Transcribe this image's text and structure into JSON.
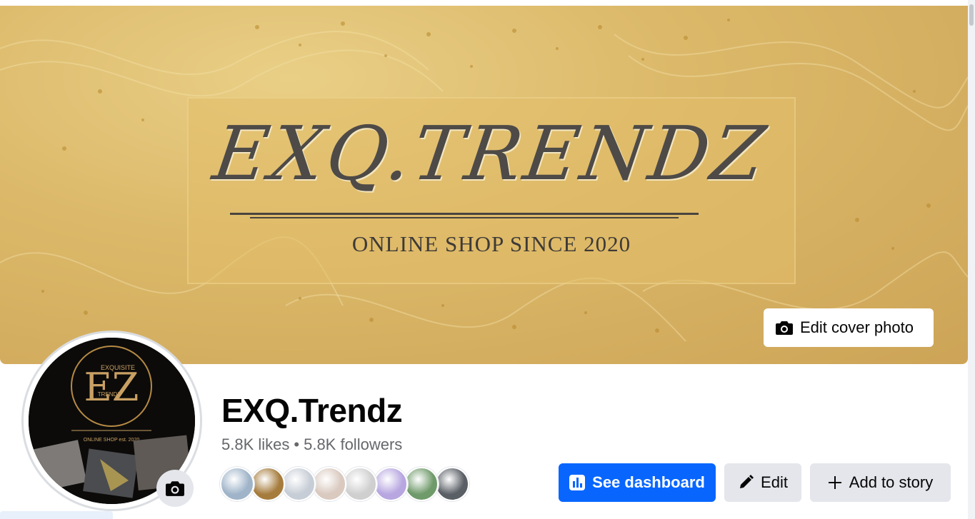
{
  "cover": {
    "brand_text": "EXQ.TRENDZ",
    "tagline": "ONLINE SHOP SINCE 2020",
    "edit_cover_label": "Edit cover photo"
  },
  "profile": {
    "avatar_initials": "EZ",
    "avatar_arc_text": "EXQUISITE",
    "avatar_sub_text": "TRENDZ",
    "avatar_caption": "ONLINE SHOP est. 2020",
    "name": "EXQ.Trendz",
    "likes": "5.8K likes",
    "separator": "•",
    "followers": "5.8K followers"
  },
  "friends": [
    {
      "name": "friend-1",
      "color": "#9fb4c9"
    },
    {
      "name": "friend-2",
      "color": "#a67c3d"
    },
    {
      "name": "friend-3",
      "color": "#c7cdd6"
    },
    {
      "name": "friend-4",
      "color": "#d9c9bf"
    },
    {
      "name": "friend-5",
      "color": "#cfcfcf"
    },
    {
      "name": "friend-6",
      "color": "#b7a6e0"
    },
    {
      "name": "friend-7",
      "color": "#6f9a6a"
    },
    {
      "name": "friend-8",
      "color": "#5a5f66"
    }
  ],
  "actions": {
    "dashboard_label": "See dashboard",
    "edit_label": "Edit",
    "add_story_label": "Add to story"
  },
  "colors": {
    "primary_blue": "#0866ff",
    "secondary_button": "#e4e6eb",
    "cover_gold": "#dcb96a",
    "text_secondary": "#65676b"
  }
}
